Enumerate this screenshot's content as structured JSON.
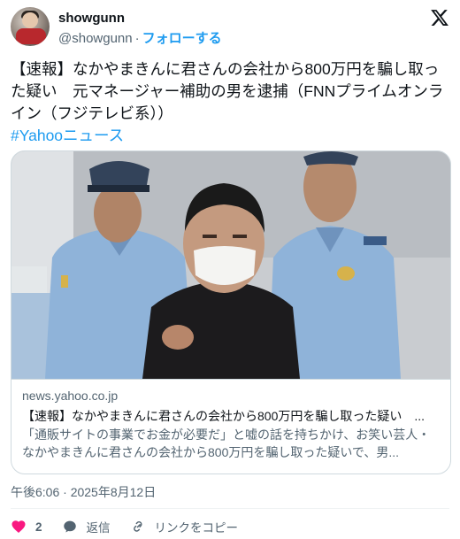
{
  "author": {
    "name": "showgunn",
    "handle": "@showgunn",
    "separator": "·",
    "follow_label": "フォローする"
  },
  "tweet": {
    "text": "【速報】なかやまきんに君さんの会社から800万円を騙し取った疑い　元マネージャー補助の男を逮捕（FNNプライムオンライン（フジテレビ系））",
    "hashtag": "#Yahooニュース"
  },
  "card": {
    "domain": "news.yahoo.co.jp",
    "title": "【速報】なかやまきんに君さんの会社から800万円を騙し取った疑い　...",
    "description": "「通販サイトの事業でお金が必要だ」と嘘の話を持ちかけ、お笑い芸人・なかやまきんに君さんの会社から800万円を騙し取った疑いで、男..."
  },
  "timestamp": "午後6:06 · 2025年8月12日",
  "actions": {
    "like_count": "2",
    "reply_label": "返信",
    "copy_link_label": "リンクをコピー"
  },
  "colors": {
    "accent": "#1d9bf0",
    "like": "#f91880",
    "muted": "#536471"
  }
}
